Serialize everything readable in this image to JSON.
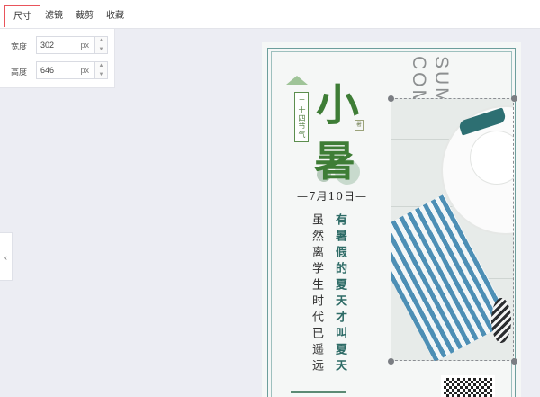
{
  "toolbar": {
    "tabs": [
      {
        "label": "尺寸",
        "active": true
      },
      {
        "label": "滤镜",
        "active": false
      },
      {
        "label": "裁剪",
        "active": false
      },
      {
        "label": "收藏",
        "active": false
      }
    ]
  },
  "dimensions": {
    "width": {
      "label": "宽度",
      "value": "302",
      "unit": "px"
    },
    "height": {
      "label": "高度",
      "value": "646",
      "unit": "px"
    }
  },
  "poster": {
    "small_vertical": "二十四节气",
    "title_1": "小",
    "title_2": "暑",
    "seal": "暑",
    "date": "—7月10日—",
    "poem_right": "有暑假的夏天才叫夏天",
    "poem_left": "虽然离学生时代已遥远",
    "english_1": "SUMMER",
    "english_2": "COMING"
  },
  "icons": {
    "collapse": "chevron-left-icon",
    "step_up": "caret-up-icon",
    "step_down": "caret-down-icon"
  },
  "colors": {
    "active_tab_border": "#e9545b",
    "title_green": "#3e7d36",
    "poem_teal": "#2d6b66"
  }
}
